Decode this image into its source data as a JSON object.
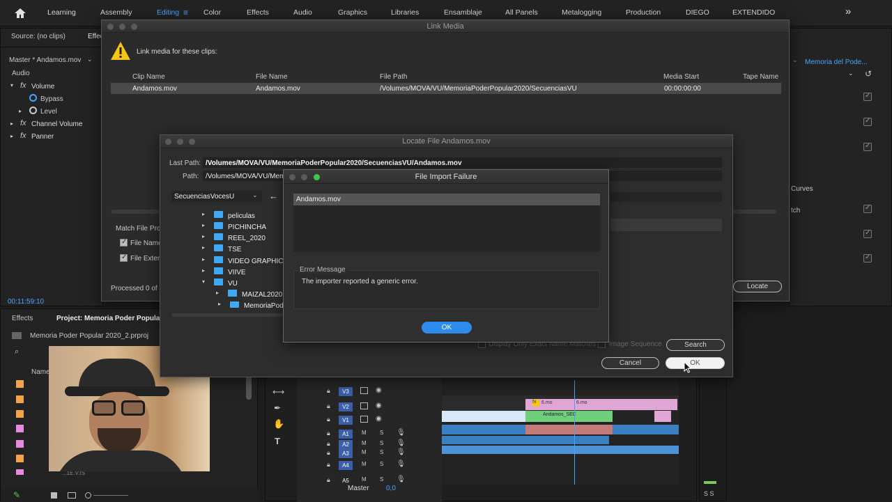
{
  "topbar": {
    "home_icon": "home-icon",
    "workspaces": [
      "Learning",
      "Assembly",
      "Editing",
      "Color",
      "Effects",
      "Audio",
      "Graphics",
      "Libraries",
      "Ensamblaje",
      "All Panels",
      "Metalogging",
      "Production",
      "DIEGO",
      "EXTENDIDO"
    ],
    "active": "Editing",
    "more_icon": "double-chevron-icon"
  },
  "source_panel": {
    "source_tab": "Source: (no clips)",
    "effects_tab": "Effec",
    "master_label": "Master * Andamos.mov",
    "audio_label": "Audio",
    "rows": [
      "Volume",
      "Bypass",
      "Level",
      "Channel Volume",
      "Panner"
    ],
    "timecode": "00:11:59:10"
  },
  "right_panel": {
    "header": "Memoria del Pode...",
    "curves": "Curves",
    "match": "tch"
  },
  "project_panel": {
    "effects_tab": "Effects",
    "project_tab": "Project: Memoria Poder Popular 2",
    "filename": "Memoria Poder Popular 2020_2.prproj",
    "name_col": "Name",
    "cut_text": "...1E.V.IS"
  },
  "link_media": {
    "title": "Link Media",
    "message": "Link media for these clips:",
    "columns": [
      "Clip Name",
      "File Name",
      "File Path",
      "Media Start",
      "Tape Name"
    ],
    "row": [
      "Andamos.mov",
      "Andamos.mov",
      "/Volumes/MOVA/VU/MemoriaPoderPopular2020/SecuenciasVU",
      "00:00:00:00",
      ""
    ],
    "match_label": "Match File Pro",
    "file_name_opt": "File Name",
    "file_ext_opt": "File Exten",
    "processed": "Processed 0 of 1",
    "locate_button": "Locate"
  },
  "locate_file": {
    "title": "Locate File Andamos.mov",
    "last_path_label": "Last Path:",
    "last_path": "/Volumes/MOVA/VU/MemoriaPoderPopular2020/SecuenciasVU/Andamos.mov",
    "path_label": "Path:",
    "path": "/Volumes/MOVA/VU/Mem",
    "dropdown": "SecuenciasVocesU",
    "folders": [
      "peliculas",
      "PICHINCHA",
      "REEL_2020",
      "TSE",
      "VIDEO GRAPHICS",
      "VIIVE",
      "VU",
      "MAIZAL2020",
      "MemoriaPode"
    ],
    "display_only": "Display Only Exact Name Matches",
    "image_sequence": "Image Sequence",
    "search_button": "Search",
    "cancel_button": "Cancel",
    "ok_button": "OK"
  },
  "import_failure": {
    "title": "File Import Failure",
    "file": "Andamos.mov",
    "error_header": "Error Message",
    "error_text": "The importer reported a generic error.",
    "ok_button": "OK"
  },
  "timeline": {
    "tracks": [
      "V3",
      "V2",
      "V1",
      "A1",
      "A2",
      "A3",
      "A4",
      "A5"
    ],
    "track_letters": [
      "M",
      "M",
      "M",
      "M",
      "M"
    ],
    "solo": "S",
    "master_label": "Master",
    "master_value": "0,0",
    "clip_v1": "Andamos_SEC",
    "clip_v2": "6.mo",
    "clip_v2b": "6.mo"
  },
  "meter": {
    "labels": "S S"
  },
  "colors": {
    "accent": "#4aa3ff",
    "ok_button": "#2d8ceb",
    "folder": "#3fa9f5",
    "track_blue": "#3a7fc0",
    "clip_green": "#6fcf7a",
    "clip_pink": "#e0a6d6",
    "warning": "#f5c518"
  }
}
